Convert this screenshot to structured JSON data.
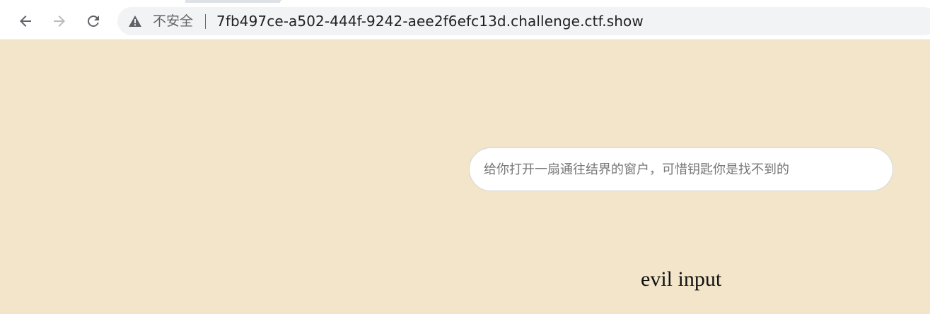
{
  "browser": {
    "back_icon": "arrow-left-icon",
    "forward_icon": "arrow-right-icon",
    "reload_icon": "reload-icon",
    "security_icon": "warning-triangle-icon",
    "security_label": "不安全",
    "url": "7fb497ce-a502-444f-9242-aee2f6efc13d.challenge.ctf.show"
  },
  "page": {
    "background_color": "#f2e5c9",
    "search": {
      "placeholder": "给你打开一扇通往结界的窗户，可惜钥匙你是找不到的",
      "value": ""
    },
    "message": "evil input"
  }
}
